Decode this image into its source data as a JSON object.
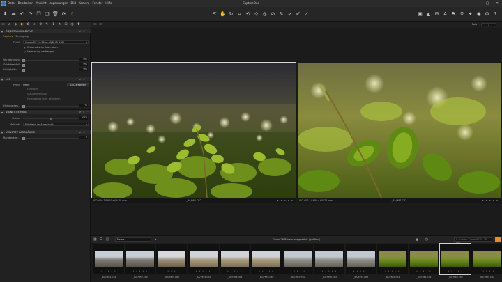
{
  "app": {
    "title": "CaptureOne",
    "menu": [
      "Datei",
      "Bearbeiten",
      "Ansicht",
      "Anpassungen",
      "Bild",
      "Kamera",
      "Fenster",
      "Hilfe"
    ],
    "window_controls": [
      "–",
      "▢",
      "✕"
    ]
  },
  "toolbar": {
    "left": [
      "import-icon",
      "eject-icon",
      "undo-icon",
      "redo-icon",
      "copy-icon",
      "paste-icon",
      "trash-icon",
      "rotate-icon",
      "process-icon"
    ],
    "left_glyphs": [
      "⬇",
      "⏏",
      "↶",
      "↷",
      "❐",
      "❏",
      "🗑",
      "⟳",
      "⇧"
    ],
    "mid_glyphs": [
      "⇱",
      "✋",
      "↻",
      "⌗",
      "⟲",
      "⊹",
      "◎",
      "⊘",
      "✎",
      "⌀",
      "✐",
      "⁄"
    ],
    "right_glyphs": [
      "▣",
      "▲",
      "⊟",
      "A",
      "⚑",
      "⚲",
      "✦",
      "◉",
      "⚙",
      "?"
    ]
  },
  "tool_tabs": [
    "▭",
    "⌂",
    "◈",
    "◐",
    "✿",
    "⌕",
    "⚙",
    "✎",
    "ℹ",
    "★",
    "⊞",
    "◑",
    "✚"
  ],
  "lens": {
    "section": "OBJEKTIVKORREKTUR",
    "tabs": [
      "Objektiv",
      "Bewegung"
    ],
    "profile_label": "Profil",
    "profile_value": "Canon EF 24-70mm f/4L IS USM",
    "chrom_ab": "Chromatische Aberration",
    "hide_distortion": "Verzerrung verbergen",
    "distortion_label": "Verzeichnung",
    "distortion_val": "0%",
    "sharp_label": "Schärfeabfall",
    "sharp_val": "0%",
    "light_label": "Helligkeitsa...",
    "light_val": "0%"
  },
  "lcc": {
    "section": "LCC",
    "profile_label": "Profil",
    "profile_value": "Ohne",
    "create_btn": "LCC erstellen",
    "opt1": "Farbstich",
    "opt2": "Staubentfernung",
    "opt3": "Homogenes Licht aktivieren",
    "homog_label": "Homogenes...",
    "homog_val": "%"
  },
  "vignette_section": {
    "section": "VIGNETTIERUNG",
    "strength_label": "Stärke",
    "strength_val": "0EV",
    "method_label": "Methode",
    "method_value": "Elliptisch im Ausschnitt"
  },
  "color_fringe": {
    "section": "VIOLETTE FARBSÄUME",
    "edge_label": "Rand entfer...",
    "edge_val": "0"
  },
  "viewer": {
    "counter": "Pola",
    "zoom": "1",
    "left_meta": "ISO 400  1/1600 s f/4 70 mm",
    "left_file": "_RA/985.CR2",
    "right_meta": "ISO 400  1/1600 s f/4 70 mm",
    "right_file": "_RA/987.CR2",
    "dots": "• • • • •"
  },
  "browser": {
    "sort_value": "Name",
    "status": "2 von 26 Bildern ausgewählt (gefiltert)",
    "search": "Suchen: Canon EF 24-70 mm",
    "stars": "• • • • •",
    "thumbs": [
      {
        "label": "_RA/7851.CR2",
        "kind": "city"
      },
      {
        "label": "_RA/7852.CR2",
        "kind": "city"
      },
      {
        "label": "_RA/7853.CR2",
        "kind": "dome"
      },
      {
        "label": "_RA/7854.CR2",
        "kind": "museum"
      },
      {
        "label": "_RA/7855.CR2",
        "kind": "museum"
      },
      {
        "label": "_RA/7856.CR2",
        "kind": "museum"
      },
      {
        "label": "_RA/7857.CR2",
        "kind": "building"
      },
      {
        "label": "_RA/7858.CR2",
        "kind": "building"
      },
      {
        "label": "_RA/7859.CR2",
        "kind": "building"
      },
      {
        "label": "_RA/7860.CR2",
        "kind": "plant"
      },
      {
        "label": "_RA/7861.CR2",
        "kind": "plant"
      },
      {
        "label": "_RA/7862.CR2",
        "kind": "plant"
      },
      {
        "label": "_RA/7863.CR2",
        "kind": "plant"
      }
    ]
  }
}
